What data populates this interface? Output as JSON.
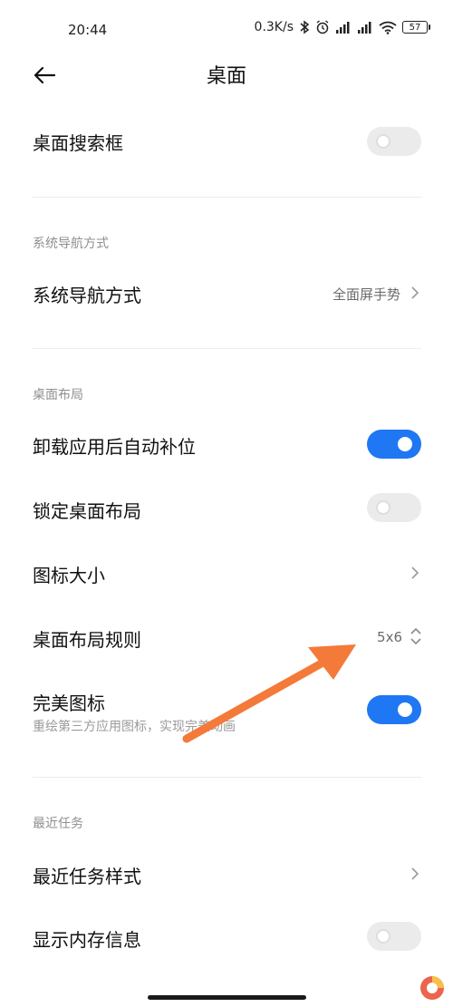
{
  "status_bar": {
    "time": "20:44",
    "net_speed": "0.3K/s",
    "battery": "57"
  },
  "header": {
    "title": "桌面"
  },
  "settings": {
    "search_box": {
      "label": "桌面搜索框",
      "enabled": false
    },
    "nav_section": {
      "header": "系统导航方式"
    },
    "nav_mode": {
      "label": "系统导航方式",
      "value": "全面屏手势"
    },
    "layout_section": {
      "header": "桌面布局"
    },
    "auto_fill": {
      "label": "卸载应用后自动补位",
      "enabled": true
    },
    "lock_layout": {
      "label": "锁定桌面布局",
      "enabled": false
    },
    "icon_size": {
      "label": "图标大小"
    },
    "layout_rule": {
      "label": "桌面布局规则",
      "value": "5x6"
    },
    "perfect_icons": {
      "label": "完美图标",
      "description": "重绘第三方应用图标，实现完美动画",
      "enabled": true
    },
    "recent_section": {
      "header": "最近任务"
    },
    "recent_style": {
      "label": "最近任务样式"
    },
    "memory_info": {
      "label": "显示内存信息",
      "enabled": false
    }
  },
  "colors": {
    "toggle_on": "#1f77f3",
    "toggle_off": "#ebebeb",
    "annotation_arrow": "#f47a3a"
  }
}
